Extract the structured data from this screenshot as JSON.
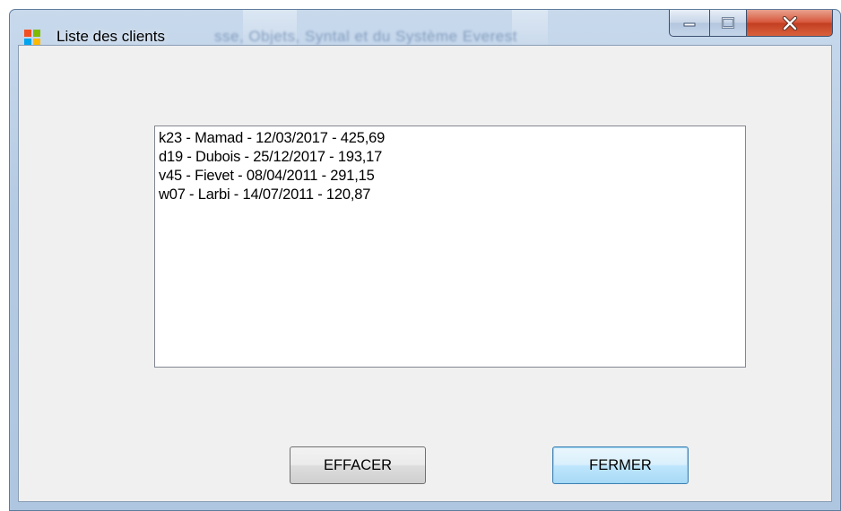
{
  "window": {
    "title": "Liste des clients",
    "background_window_text": "sse, Objets, Syntal et du Système Everest"
  },
  "listbox": {
    "items": [
      "k23 - Mamad - 12/03/2017 - 425,69",
      "d19 - Dubois - 25/12/2017 - 193,17",
      "v45 - Fievet - 08/04/2011 - 291,15",
      "w07 - Larbi - 14/07/2011 - 120,87"
    ]
  },
  "buttons": {
    "effacer_label": "EFFACER",
    "fermer_label": "FERMER"
  },
  "colors": {
    "close_button": "#c94a2e",
    "default_button_border": "#3c7fb1",
    "client_background": "#f0f0f0"
  },
  "icons": {
    "app": "windows-form-icon",
    "minimize": "minimize-icon",
    "maximize": "maximize-icon",
    "close": "close-icon"
  }
}
